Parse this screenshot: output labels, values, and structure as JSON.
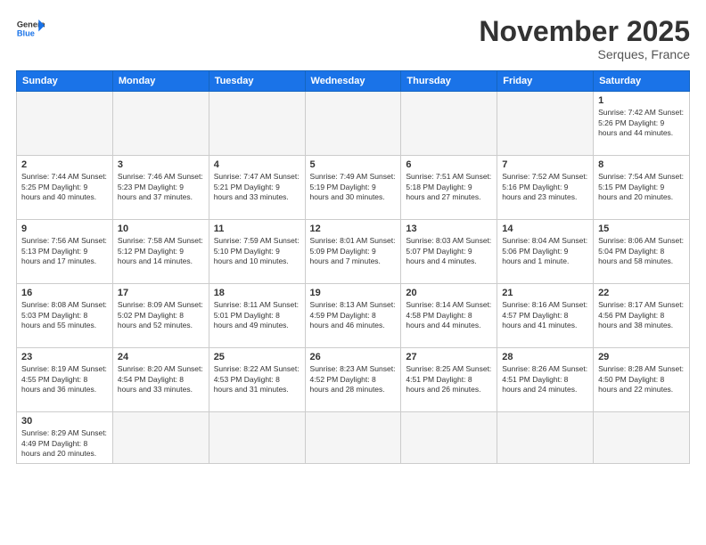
{
  "header": {
    "logo_general": "General",
    "logo_blue": "Blue",
    "month_title": "November 2025",
    "location": "Serques, France"
  },
  "weekdays": [
    "Sunday",
    "Monday",
    "Tuesday",
    "Wednesday",
    "Thursday",
    "Friday",
    "Saturday"
  ],
  "weeks": [
    [
      {
        "day": "",
        "empty": true
      },
      {
        "day": "",
        "empty": true
      },
      {
        "day": "",
        "empty": true
      },
      {
        "day": "",
        "empty": true
      },
      {
        "day": "",
        "empty": true
      },
      {
        "day": "",
        "empty": true
      },
      {
        "day": "1",
        "info": "Sunrise: 7:42 AM\nSunset: 5:26 PM\nDaylight: 9 hours\nand 44 minutes."
      }
    ],
    [
      {
        "day": "2",
        "info": "Sunrise: 7:44 AM\nSunset: 5:25 PM\nDaylight: 9 hours\nand 40 minutes."
      },
      {
        "day": "3",
        "info": "Sunrise: 7:46 AM\nSunset: 5:23 PM\nDaylight: 9 hours\nand 37 minutes."
      },
      {
        "day": "4",
        "info": "Sunrise: 7:47 AM\nSunset: 5:21 PM\nDaylight: 9 hours\nand 33 minutes."
      },
      {
        "day": "5",
        "info": "Sunrise: 7:49 AM\nSunset: 5:19 PM\nDaylight: 9 hours\nand 30 minutes."
      },
      {
        "day": "6",
        "info": "Sunrise: 7:51 AM\nSunset: 5:18 PM\nDaylight: 9 hours\nand 27 minutes."
      },
      {
        "day": "7",
        "info": "Sunrise: 7:52 AM\nSunset: 5:16 PM\nDaylight: 9 hours\nand 23 minutes."
      },
      {
        "day": "8",
        "info": "Sunrise: 7:54 AM\nSunset: 5:15 PM\nDaylight: 9 hours\nand 20 minutes."
      }
    ],
    [
      {
        "day": "9",
        "info": "Sunrise: 7:56 AM\nSunset: 5:13 PM\nDaylight: 9 hours\nand 17 minutes."
      },
      {
        "day": "10",
        "info": "Sunrise: 7:58 AM\nSunset: 5:12 PM\nDaylight: 9 hours\nand 14 minutes."
      },
      {
        "day": "11",
        "info": "Sunrise: 7:59 AM\nSunset: 5:10 PM\nDaylight: 9 hours\nand 10 minutes."
      },
      {
        "day": "12",
        "info": "Sunrise: 8:01 AM\nSunset: 5:09 PM\nDaylight: 9 hours\nand 7 minutes."
      },
      {
        "day": "13",
        "info": "Sunrise: 8:03 AM\nSunset: 5:07 PM\nDaylight: 9 hours\nand 4 minutes."
      },
      {
        "day": "14",
        "info": "Sunrise: 8:04 AM\nSunset: 5:06 PM\nDaylight: 9 hours\nand 1 minute."
      },
      {
        "day": "15",
        "info": "Sunrise: 8:06 AM\nSunset: 5:04 PM\nDaylight: 8 hours\nand 58 minutes."
      }
    ],
    [
      {
        "day": "16",
        "info": "Sunrise: 8:08 AM\nSunset: 5:03 PM\nDaylight: 8 hours\nand 55 minutes."
      },
      {
        "day": "17",
        "info": "Sunrise: 8:09 AM\nSunset: 5:02 PM\nDaylight: 8 hours\nand 52 minutes."
      },
      {
        "day": "18",
        "info": "Sunrise: 8:11 AM\nSunset: 5:01 PM\nDaylight: 8 hours\nand 49 minutes."
      },
      {
        "day": "19",
        "info": "Sunrise: 8:13 AM\nSunset: 4:59 PM\nDaylight: 8 hours\nand 46 minutes."
      },
      {
        "day": "20",
        "info": "Sunrise: 8:14 AM\nSunset: 4:58 PM\nDaylight: 8 hours\nand 44 minutes."
      },
      {
        "day": "21",
        "info": "Sunrise: 8:16 AM\nSunset: 4:57 PM\nDaylight: 8 hours\nand 41 minutes."
      },
      {
        "day": "22",
        "info": "Sunrise: 8:17 AM\nSunset: 4:56 PM\nDaylight: 8 hours\nand 38 minutes."
      }
    ],
    [
      {
        "day": "23",
        "info": "Sunrise: 8:19 AM\nSunset: 4:55 PM\nDaylight: 8 hours\nand 36 minutes."
      },
      {
        "day": "24",
        "info": "Sunrise: 8:20 AM\nSunset: 4:54 PM\nDaylight: 8 hours\nand 33 minutes."
      },
      {
        "day": "25",
        "info": "Sunrise: 8:22 AM\nSunset: 4:53 PM\nDaylight: 8 hours\nand 31 minutes."
      },
      {
        "day": "26",
        "info": "Sunrise: 8:23 AM\nSunset: 4:52 PM\nDaylight: 8 hours\nand 28 minutes."
      },
      {
        "day": "27",
        "info": "Sunrise: 8:25 AM\nSunset: 4:51 PM\nDaylight: 8 hours\nand 26 minutes."
      },
      {
        "day": "28",
        "info": "Sunrise: 8:26 AM\nSunset: 4:51 PM\nDaylight: 8 hours\nand 24 minutes."
      },
      {
        "day": "29",
        "info": "Sunrise: 8:28 AM\nSunset: 4:50 PM\nDaylight: 8 hours\nand 22 minutes."
      }
    ],
    [
      {
        "day": "30",
        "info": "Sunrise: 8:29 AM\nSunset: 4:49 PM\nDaylight: 8 hours\nand 20 minutes."
      },
      {
        "day": "",
        "empty": true
      },
      {
        "day": "",
        "empty": true
      },
      {
        "day": "",
        "empty": true
      },
      {
        "day": "",
        "empty": true
      },
      {
        "day": "",
        "empty": true
      },
      {
        "day": "",
        "empty": true
      }
    ]
  ]
}
